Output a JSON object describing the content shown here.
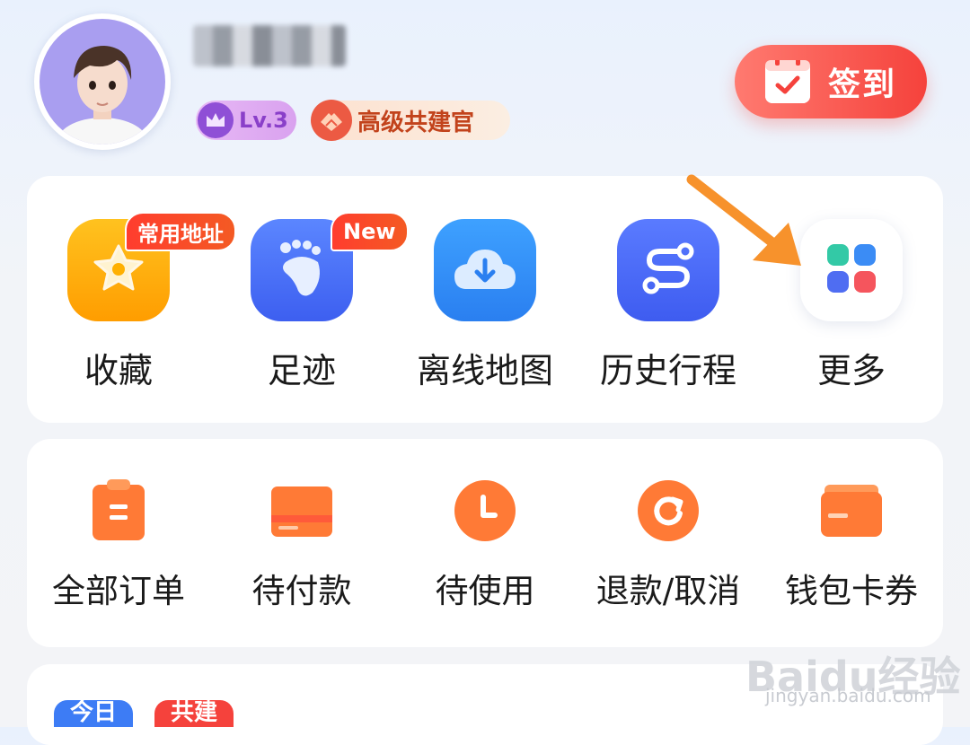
{
  "header": {
    "level_badge": "Lv.3",
    "title_badge": "高级共建官",
    "signin_label": "签到"
  },
  "shortcuts": [
    {
      "label": "收藏",
      "icon": "star-icon",
      "tag": "常用地址",
      "color": "#ffa800"
    },
    {
      "label": "足迹",
      "icon": "footprint-icon",
      "tag": "New",
      "color": "#4a72f5"
    },
    {
      "label": "离线地图",
      "icon": "cloud-download-icon",
      "tag": "",
      "color": "#2f86f6"
    },
    {
      "label": "历史行程",
      "icon": "route-icon",
      "tag": "",
      "color": "#4466f2"
    },
    {
      "label": "更多",
      "icon": "grid-icon",
      "tag": "",
      "color": "#ffffff"
    }
  ],
  "orders": [
    {
      "label": "全部订单",
      "icon": "clipboard-icon"
    },
    {
      "label": "待付款",
      "icon": "card-icon"
    },
    {
      "label": "待使用",
      "icon": "clock-icon"
    },
    {
      "label": "退款/取消",
      "icon": "refund-icon"
    },
    {
      "label": "钱包卡券",
      "icon": "wallet-icon"
    }
  ],
  "bottom_card": {
    "pill1": "今日",
    "pill2": "共建"
  },
  "watermark": {
    "main": "Baidu经验",
    "sub": "jingyan.baidu.com"
  },
  "colors": {
    "accent_red": "#f5423c",
    "arrow_orange": "#f7922c"
  }
}
